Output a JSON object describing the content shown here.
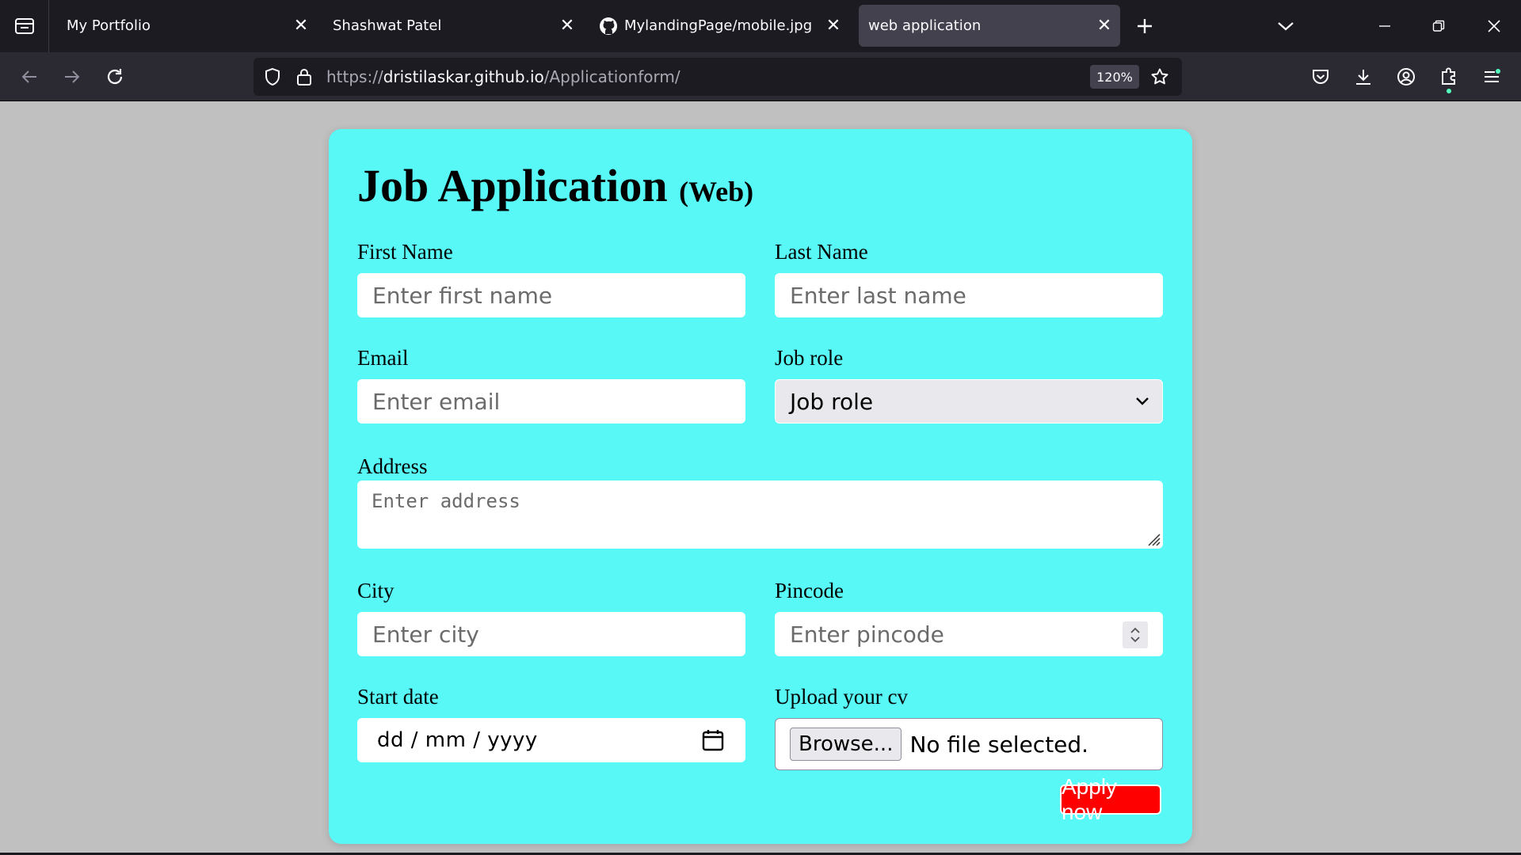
{
  "browser": {
    "tabs": [
      {
        "title": "My Portfolio",
        "active": false
      },
      {
        "title": "Shashwat Patel",
        "active": false
      },
      {
        "title": "MylandingPage/mobile.jpg at m",
        "active": false,
        "icon": "github-icon"
      },
      {
        "title": "web application",
        "active": true
      }
    ],
    "close_glyph": "✕",
    "url": {
      "prefix": "https://",
      "host": "dristilaskar.github.io",
      "path": "/Applicationform/"
    },
    "zoom": "120%"
  },
  "form": {
    "title": "Job Application",
    "subtitle": "(Web)",
    "first_name": {
      "label": "First Name",
      "placeholder": "Enter first name"
    },
    "last_name": {
      "label": "Last Name",
      "placeholder": "Enter last name"
    },
    "email": {
      "label": "Email",
      "placeholder": "Enter email"
    },
    "job_role": {
      "label": "Job role",
      "selected": "Job role"
    },
    "address": {
      "label": "Address",
      "placeholder": "Enter address"
    },
    "city": {
      "label": "City",
      "placeholder": "Enter city"
    },
    "pincode": {
      "label": "Pincode",
      "placeholder": "Enter pincode"
    },
    "start_date": {
      "label": "Start date",
      "placeholder": "dd / mm / yyyy"
    },
    "cv": {
      "label": "Upload your cv",
      "button": "Browse...",
      "status": "No file selected."
    },
    "submit": "Apply now"
  },
  "colors": {
    "card": "#57f8f6",
    "page_bg": "#c0c0c0",
    "submit_bg": "#ff0000",
    "chrome_dark": "#1c1b22"
  }
}
